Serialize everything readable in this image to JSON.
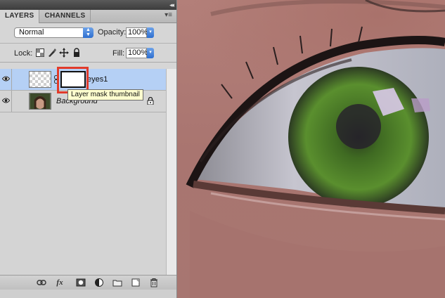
{
  "panel": {
    "collapse_glyph": "◂◂",
    "tabs": [
      {
        "label": "LAYERS",
        "active": true
      },
      {
        "label": "CHANNELS",
        "active": false
      }
    ],
    "menu_glyph": "▾≡",
    "blend_mode": "Normal",
    "opacity_label": "Opacity:",
    "opacity_value": "100%",
    "lock_label": "Lock:",
    "fill_label": "Fill:",
    "fill_value": "100%"
  },
  "layers": [
    {
      "name": "eyes1",
      "visible": true,
      "selected": true,
      "has_mask": true
    },
    {
      "name": "Background",
      "visible": true,
      "selected": false,
      "locked": true
    }
  ],
  "tooltip": "Layer mask thumbnail",
  "bottom_icons": [
    "link-layers-icon",
    "fx-icon",
    "add-mask-icon",
    "adjustment-layer-icon",
    "new-group-icon",
    "new-layer-icon",
    "trash-icon"
  ],
  "bottom_fx_label": "fx",
  "colors": {
    "highlight": "#e23b2a",
    "selection": "#b5d0f5",
    "tooltip_bg": "#ffffcf"
  }
}
